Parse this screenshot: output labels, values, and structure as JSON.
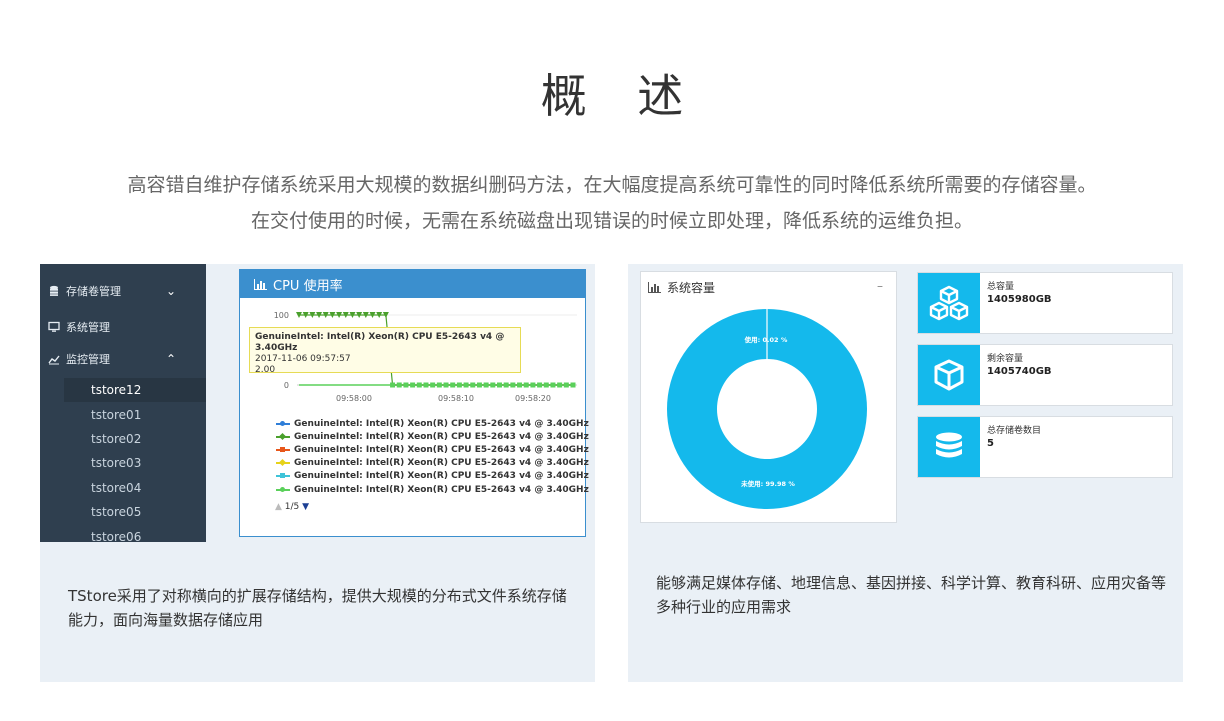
{
  "header": {
    "title": "概 述",
    "intro_line1": "高容错自维护存储系统采用大规模的数据纠删码方法，在大幅度提高系统可靠性的同时降低系统所需要的存储容量。",
    "intro_line2": "在交付使用的时候，无需在系统磁盘出现错误的时候立即处理，降低系统的运维负担。"
  },
  "sidebar": {
    "items": [
      {
        "label": "存储卷管理",
        "icon": "database-icon"
      },
      {
        "label": "系统管理",
        "icon": "monitor-icon"
      },
      {
        "label": "监控管理",
        "icon": "line-chart-icon"
      }
    ],
    "sub_items": [
      "tstore12",
      "tstore01",
      "tstore02",
      "tstore03",
      "tstore04",
      "tstore05",
      "tstore06"
    ]
  },
  "cpu_widget": {
    "title": "CPU 使用率",
    "tooltip": {
      "name": "GenuineIntel: Intel(R) Xeon(R) CPU E5-2643 v4 @ 3.40GHz",
      "time": "2017-11-06 09:57:57",
      "value": "2.00"
    },
    "legend_colors": [
      "#2f7ed8",
      "#4aa02c",
      "#e8571b",
      "#e6d21a",
      "#3ec3d8",
      "#5ad05a"
    ],
    "legend": [
      "GenuineIntel: Intel(R) Xeon(R) CPU E5-2643 v4 @ 3.40GHz",
      "GenuineIntel: Intel(R) Xeon(R) CPU E5-2643 v4 @ 3.40GHz",
      "GenuineIntel: Intel(R) Xeon(R) CPU E5-2643 v4 @ 3.40GHz",
      "GenuineIntel: Intel(R) Xeon(R) CPU E5-2643 v4 @ 3.40GHz",
      "GenuineIntel: Intel(R) Xeon(R) CPU E5-2643 v4 @ 3.40GHz",
      "GenuineIntel: Intel(R) Xeon(R) CPU E5-2643 v4 @ 3.40GHz"
    ],
    "pager": "1/5"
  },
  "chart_data": [
    {
      "type": "line",
      "x_ticks": [
        "09:58:00",
        "09:58:10",
        "09:58:20"
      ],
      "y_ticks": [
        "100",
        "0"
      ],
      "ylim": [
        0,
        100
      ],
      "series_values": [
        100,
        100,
        100,
        100,
        100,
        100,
        100,
        100,
        100,
        100,
        100,
        100,
        100,
        100,
        0,
        0,
        0,
        0,
        0,
        0,
        0,
        0,
        0,
        0,
        0,
        0,
        0,
        0,
        0,
        0,
        0,
        0,
        0,
        0,
        0,
        0,
        0,
        0,
        0,
        0,
        0,
        0
      ]
    },
    {
      "type": "pie",
      "title": "系统容量",
      "slices": [
        {
          "label": "使用: 0.02 %",
          "value": 0.02,
          "color": "#ffffff"
        },
        {
          "label": "未使用: 99.98 %",
          "value": 99.98,
          "color": "#14b9ec"
        }
      ]
    }
  ],
  "capacity_widget": {
    "title": "系统容量",
    "minimize": "–"
  },
  "stats": [
    {
      "label": "总容量",
      "value": "1405980GB",
      "icon": "cubes-icon"
    },
    {
      "label": "剩余容量",
      "value": "1405740GB",
      "icon": "cube-icon"
    },
    {
      "label": "总存储卷数目",
      "value": "5",
      "icon": "database-icon"
    }
  ],
  "descriptions": {
    "left": "TStore采用了对称横向的扩展存储结构，提供大规模的分布式文件系统存储能力，面向海量数据存储应用",
    "right": "能够满足媒体存储、地理信息、基因拼接、科学计算、教育科研、应用灾备等多种行业的应用需求"
  }
}
